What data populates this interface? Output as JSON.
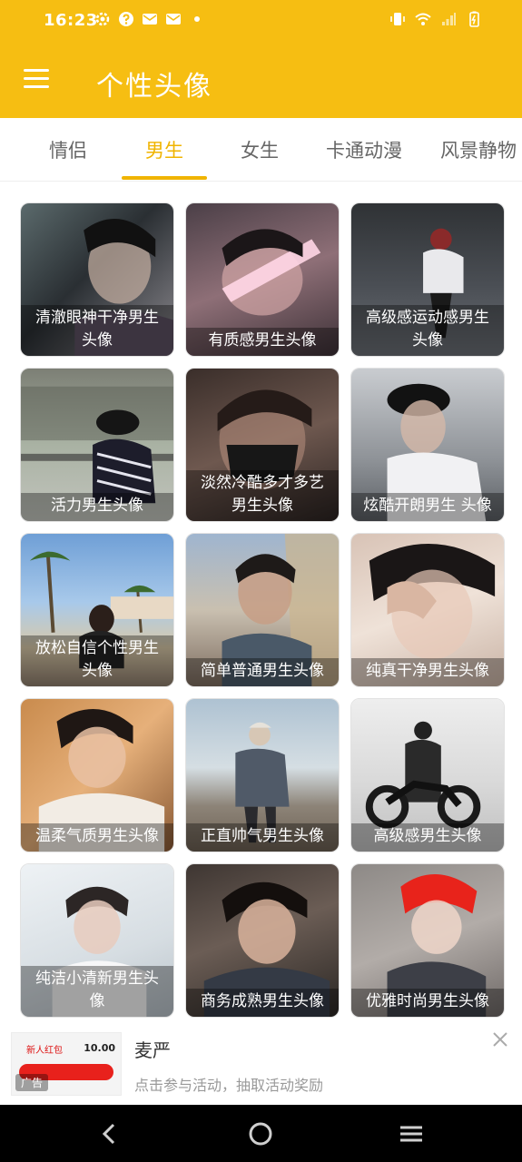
{
  "status_bar": {
    "time": "16:23",
    "left_icons": [
      "settings-icon",
      "help-icon",
      "mail-icon",
      "mail-icon",
      "dot-icon"
    ],
    "right_icons": [
      "vibrate-icon",
      "wifi-icon",
      "signal-icon",
      "battery-icon"
    ]
  },
  "app_bar": {
    "title": "个性头像",
    "menu_icon": "hamburger-menu-icon",
    "color": "#F6BE12"
  },
  "tabs": {
    "items": [
      {
        "label": "情侣",
        "active": false
      },
      {
        "label": "男生",
        "active": true
      },
      {
        "label": "女生",
        "active": false
      },
      {
        "label": "卡通动漫",
        "active": false
      },
      {
        "label": "风景静物",
        "active": false
      }
    ],
    "active_color": "#F0B400"
  },
  "grid": {
    "cards": [
      {
        "caption": "清澈眼神干净男生头像"
      },
      {
        "caption": "有质感男生头像"
      },
      {
        "caption": "高级感运动感男生头像"
      },
      {
        "caption": "活力男生头像"
      },
      {
        "caption": "淡然冷酷多才多艺男生头像"
      },
      {
        "caption": "炫酷开朗男生 头像"
      },
      {
        "caption": "放松自信个性男生头像"
      },
      {
        "caption": "简单普通男生头像"
      },
      {
        "caption": "纯真干净男生头像"
      },
      {
        "caption": "温柔气质男生头像"
      },
      {
        "caption": "正直帅气男生头像"
      },
      {
        "caption": "高级感男生头像"
      },
      {
        "caption": "纯洁小清新男生头像"
      },
      {
        "caption": "商务成熟男生头像"
      },
      {
        "caption": "优雅时尚男生头像"
      }
    ]
  },
  "ad": {
    "title": "麦严",
    "description": "点击参与活动，抽取活动奖励",
    "label": "广告",
    "thumb_text": "新人红包",
    "thumb_price": "10.00",
    "close_icon": "close-icon"
  },
  "nav_bar": {
    "icons": [
      "back-icon",
      "home-icon",
      "recents-icon"
    ]
  }
}
